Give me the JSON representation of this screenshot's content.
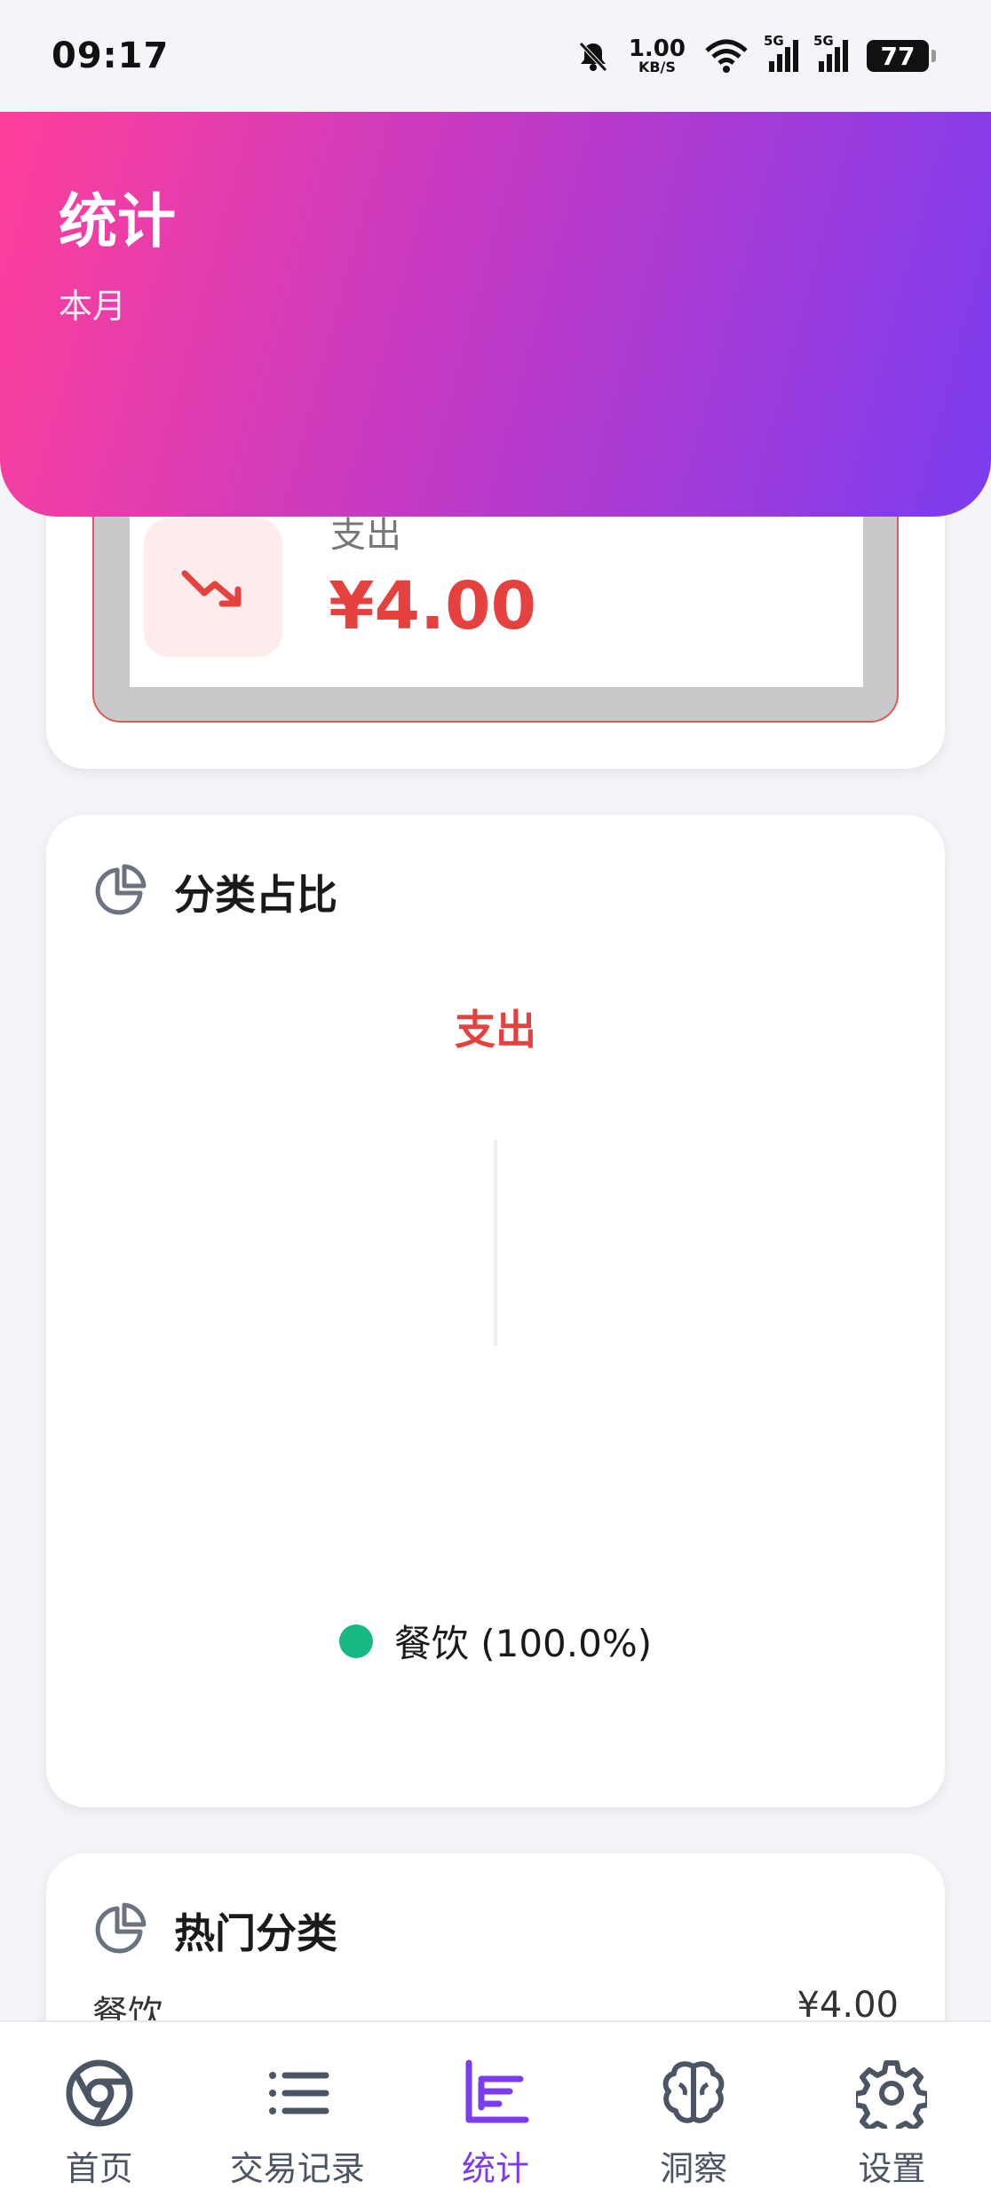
{
  "status_bar": {
    "time": "09:17",
    "net_speed_value": "1.00",
    "net_speed_unit": "KB/S",
    "signal_tag_1": "5G",
    "signal_tag_2": "5G",
    "battery": "77"
  },
  "header": {
    "title": "统计",
    "subtitle": "本月"
  },
  "summary": {
    "expense_label": "支出",
    "expense_amount": "¥4.00",
    "accent_color": "#e5413e"
  },
  "category_share": {
    "title": "分类占比",
    "center_label": "支出",
    "legend": [
      {
        "label": "餐饮 (100.0%)",
        "color": "#16b884",
        "percent": 100.0
      }
    ]
  },
  "top_categories": {
    "title": "热门分类",
    "rows": [
      {
        "name": "餐饮",
        "amount": "¥4.00"
      }
    ]
  },
  "nav": {
    "items": [
      {
        "label": "首页",
        "icon": "chrome-home-icon"
      },
      {
        "label": "交易记录",
        "icon": "list-icon"
      },
      {
        "label": "统计",
        "icon": "bar-chart-icon",
        "active": true
      },
      {
        "label": "洞察",
        "icon": "brain-icon"
      },
      {
        "label": "设置",
        "icon": "gear-icon"
      }
    ]
  }
}
